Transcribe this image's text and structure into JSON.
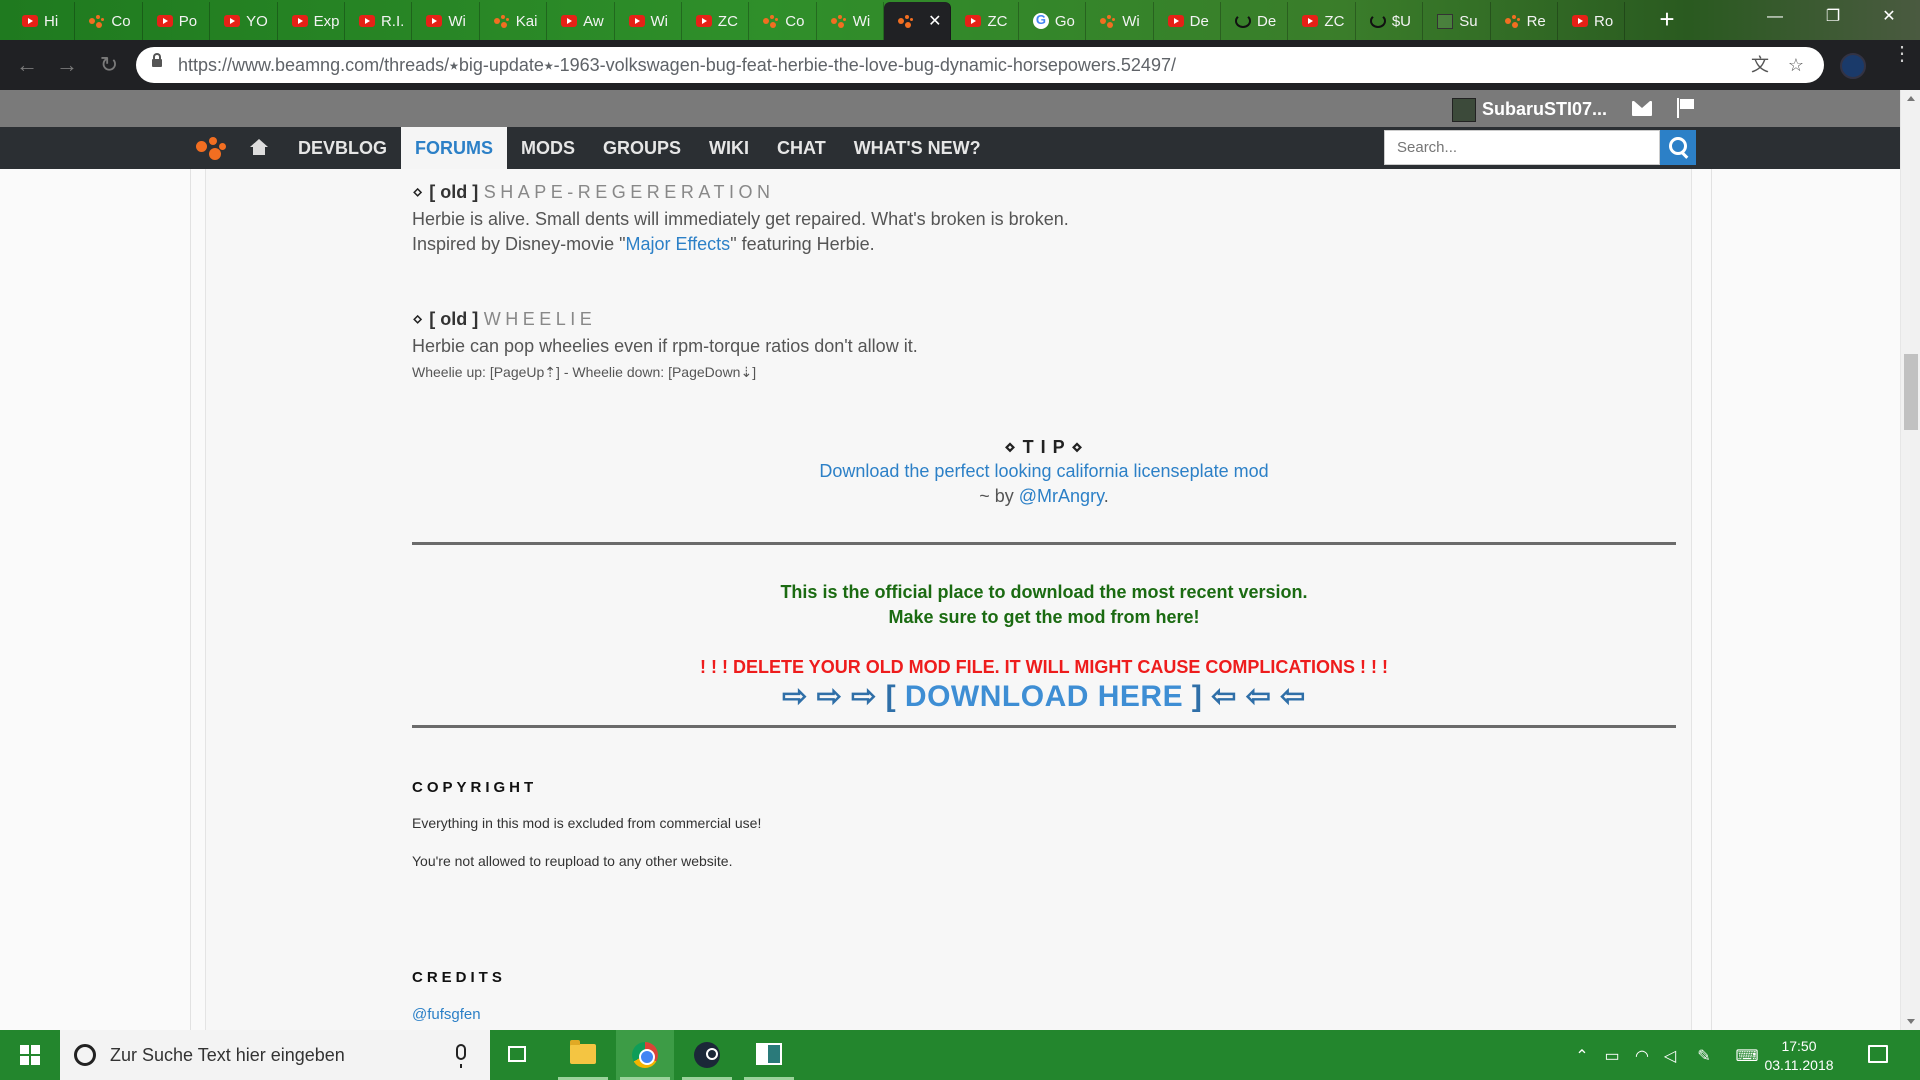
{
  "browser": {
    "tabs": [
      {
        "icon": "youtube",
        "label": "Hi"
      },
      {
        "icon": "beamng",
        "label": "Co"
      },
      {
        "icon": "youtube",
        "label": "Po"
      },
      {
        "icon": "youtube",
        "label": "YO"
      },
      {
        "icon": "youtube",
        "label": "Exp"
      },
      {
        "icon": "youtube",
        "label": "R.I."
      },
      {
        "icon": "youtube",
        "label": "Wi"
      },
      {
        "icon": "beamng",
        "label": "Kai"
      },
      {
        "icon": "youtube",
        "label": "Aw"
      },
      {
        "icon": "youtube",
        "label": "Wi"
      },
      {
        "icon": "youtube",
        "label": "ZC"
      },
      {
        "icon": "beamng",
        "label": "Co"
      },
      {
        "icon": "beamng",
        "label": "Wi"
      },
      {
        "icon": "beamng",
        "label": "",
        "active": true
      },
      {
        "icon": "youtube",
        "label": "ZC"
      },
      {
        "icon": "google",
        "label": "Go"
      },
      {
        "icon": "beamng",
        "label": "Wi"
      },
      {
        "icon": "youtube",
        "label": "De"
      },
      {
        "icon": "power",
        "label": "De"
      },
      {
        "icon": "youtube",
        "label": "ZC"
      },
      {
        "icon": "power",
        "label": "$U"
      },
      {
        "icon": "doc",
        "label": "Su"
      },
      {
        "icon": "beamng",
        "label": "Re"
      },
      {
        "icon": "youtube",
        "label": "Ro"
      }
    ],
    "active_tab_close": "✕",
    "new_tab": "+",
    "window_controls": {
      "minimize": "—",
      "restore": "❐",
      "close": "✕"
    },
    "url": "https://www.beamng.com/threads/⭑big-update⭑-1963-volkswagen-bug-feat-herbie-the-love-bug-dynamic-horsepowers.52497/"
  },
  "site": {
    "username": "SubaruSTI07...",
    "nav": [
      "DEVBLOG",
      "FORUMS",
      "MODS",
      "GROUPS",
      "WIKI",
      "CHAT",
      "WHAT'S NEW?"
    ],
    "active_nav": "FORUMS",
    "search_placeholder": "Search..."
  },
  "post": {
    "shape": {
      "bullet": "⋄ ",
      "tag": "[ old ]",
      "name": "SHAPE-REGERERATION",
      "line1": "Herbie is alive. Small dents will immediately get repaired. What's broken is broken.",
      "line2_before": "Inspired by Disney-movie \"",
      "line2_link": "Major Effects",
      "line2_after": "\" featuring Herbie."
    },
    "wheelie": {
      "bullet": "⋄ ",
      "tag": "[ old ]",
      "name": "WHEELIE",
      "line1": "Herbie can pop wheelies even if rpm-torque ratios don't allow it.",
      "keys": "Wheelie up: [PageUp⇡] - Wheelie down: [PageDown⇣]"
    },
    "tip": {
      "title": "⋄ T I P ⋄",
      "link": "Download the perfect looking california licenseplate mod",
      "by_prefix": "~ by ",
      "by_link": "@MrAngry",
      "by_suffix": "."
    },
    "official_1": "This is the official place to download the most recent version.",
    "official_2": "Make sure to get the mod from here!",
    "warning": "! ! ! DELETE YOUR OLD MOD FILE. IT WILL MIGHT CAUSE COMPLICATIONS ! ! !",
    "download": {
      "left_arrows": "⇨ ⇨ ⇨ ",
      "open": "[ ",
      "label": "DOWNLOAD HERE",
      "close": " ]",
      "right_arrows": " ⇦ ⇦ ⇦"
    },
    "copyright_title": "COPYRIGHT",
    "copyright_1": "Everything in this mod is excluded from commercial use!",
    "copyright_2": "You're not allowed to reupload to any other website.",
    "credits_title": "CREDITS",
    "credit_1": "@fufsgfen"
  },
  "taskbar": {
    "search_placeholder": "Zur Suche Text hier eingeben",
    "time": "17:50",
    "date": "03.11.2018",
    "tray_icons": [
      "chevron-up-icon",
      "battery-icon",
      "wifi-icon",
      "volume-icon",
      "pen-icon",
      "keyboard-icon"
    ]
  }
}
